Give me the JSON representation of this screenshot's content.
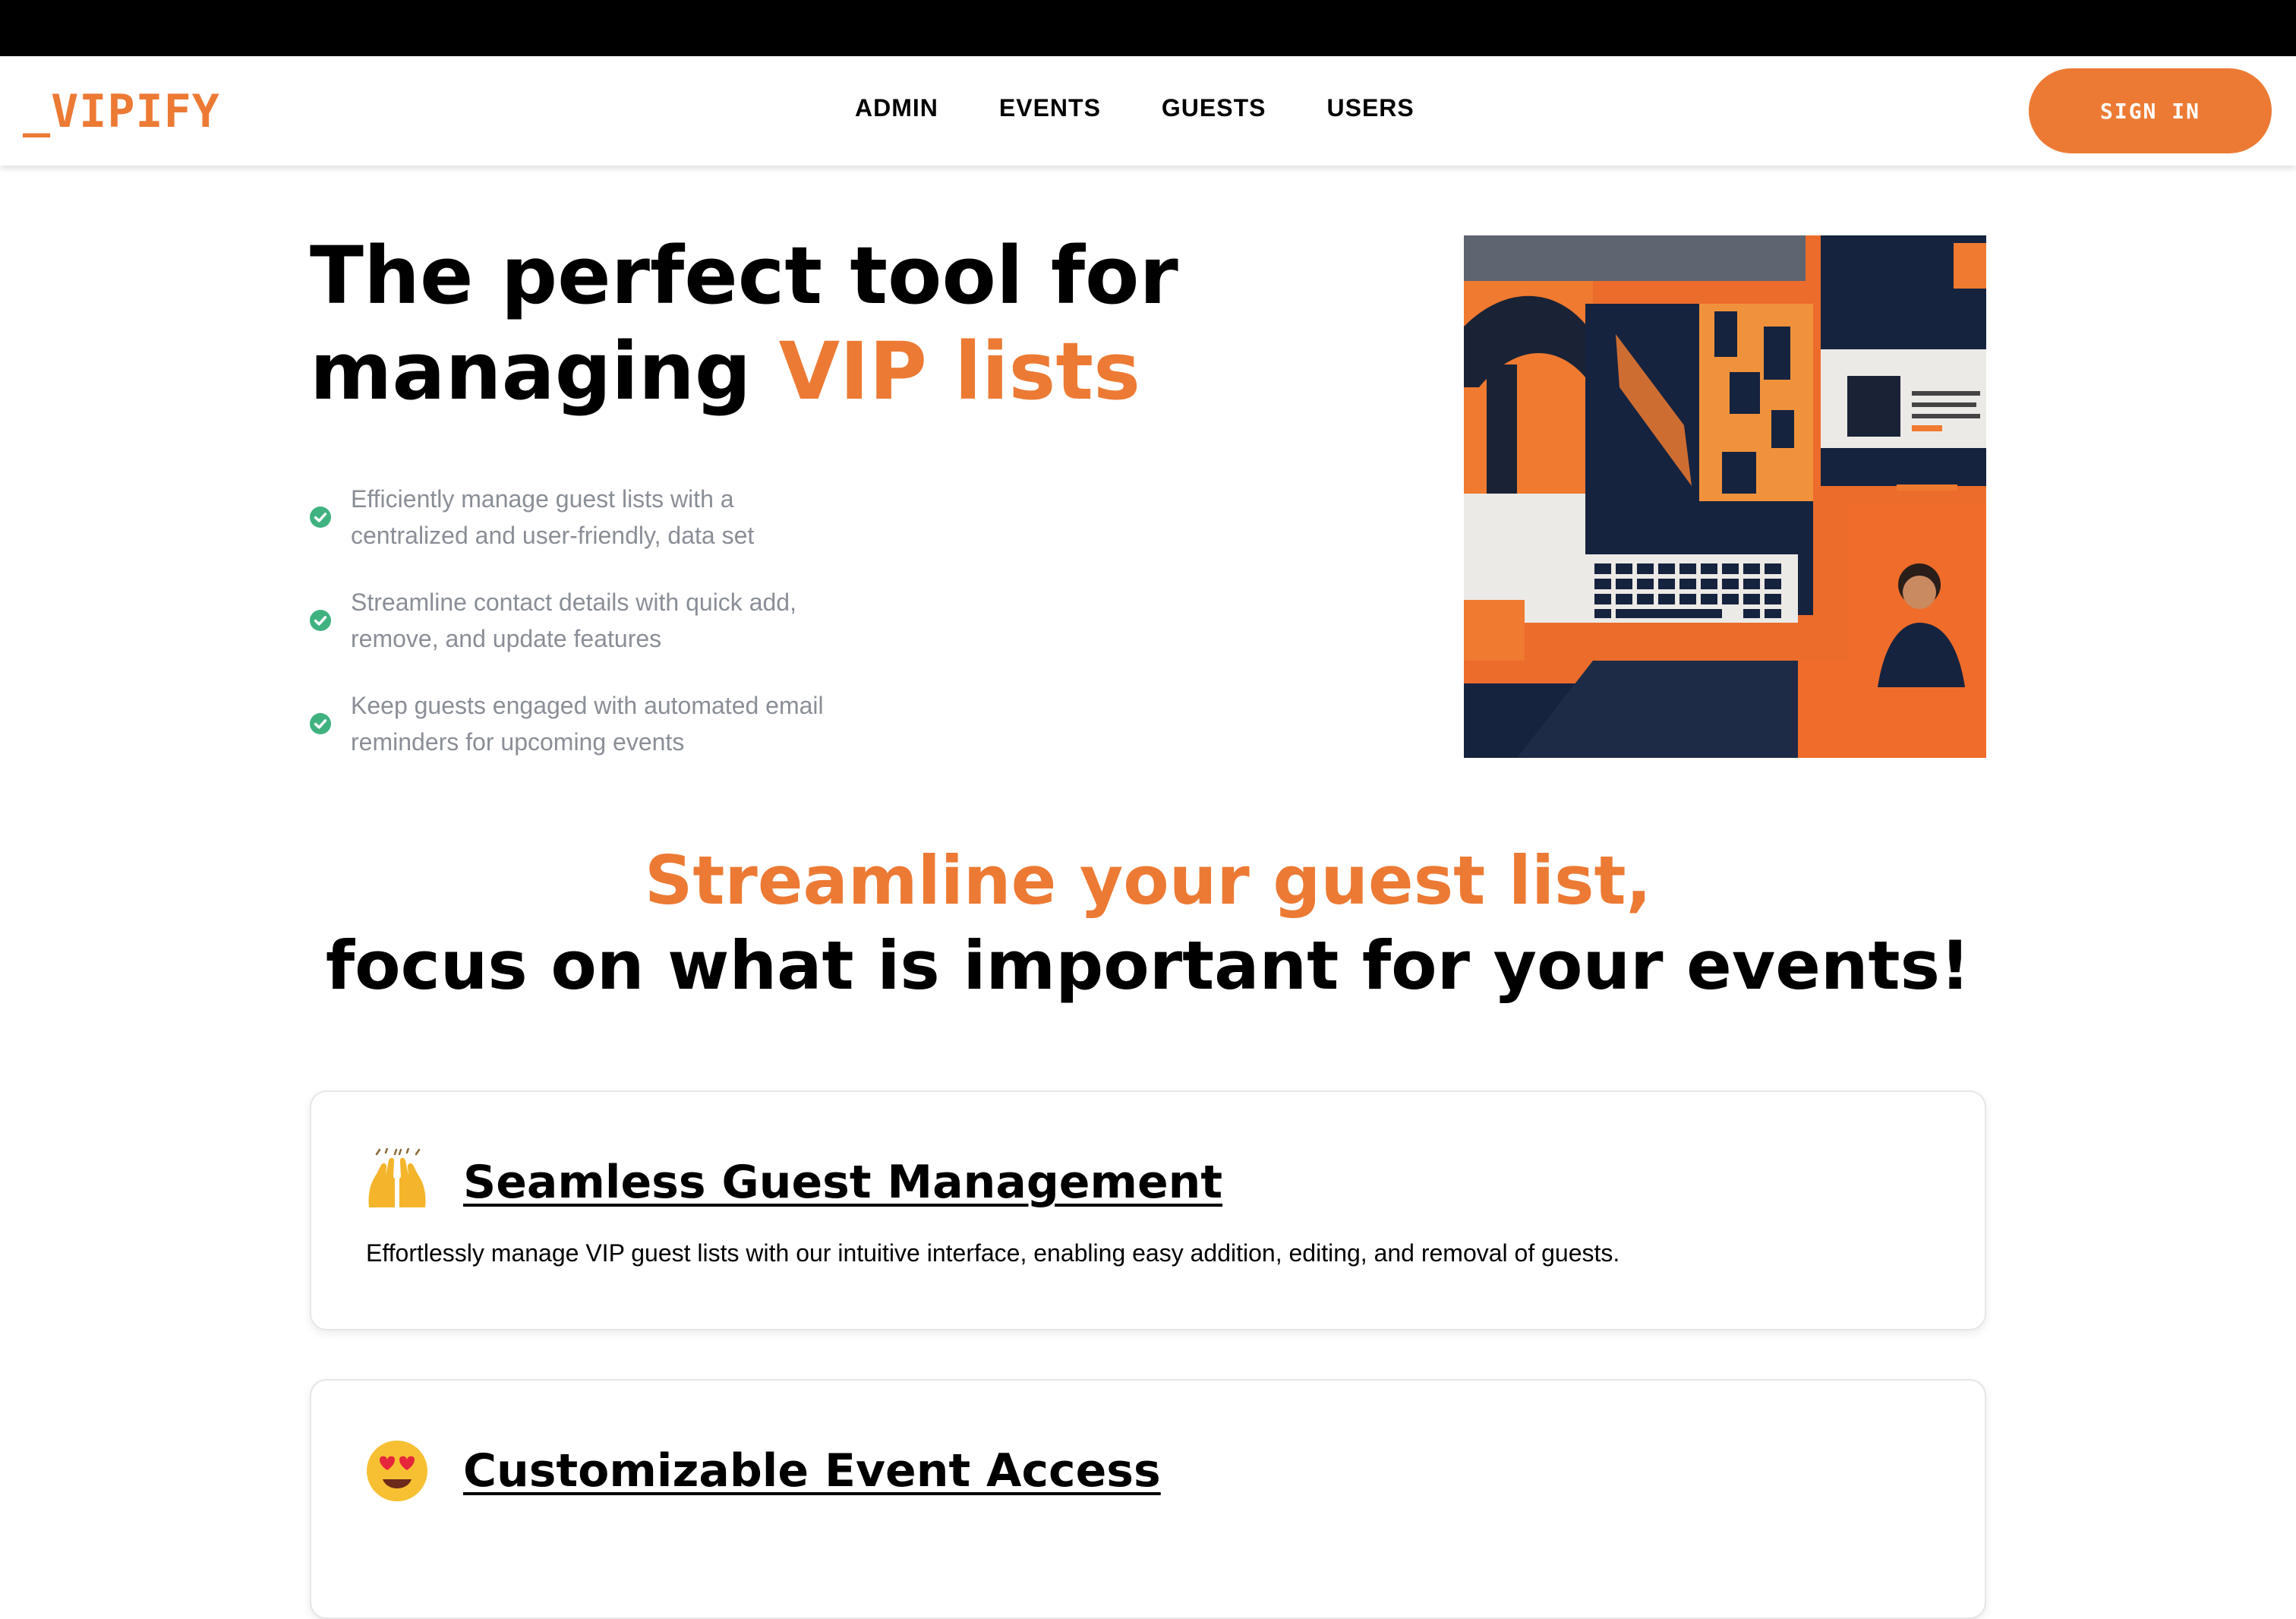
{
  "header": {
    "logo": "_VIPIFY",
    "nav": [
      {
        "label": "ADMIN"
      },
      {
        "label": "EVENTS"
      },
      {
        "label": "GUESTS"
      },
      {
        "label": "USERS"
      }
    ],
    "sign_in_label": "SIGN IN"
  },
  "hero": {
    "title_line1": "The perfect tool for",
    "title_line2_prefix": "managing ",
    "title_line2_accent": "VIP lists",
    "features": [
      {
        "icon": "check-circle-icon",
        "text": "Efficiently manage guest lists with a centralized and user-friendly, data set"
      },
      {
        "icon": "check-circle-icon",
        "text": "Streamline contact details with quick add, remove, and update features"
      },
      {
        "icon": "check-circle-icon",
        "text": "Keep guests engaged with automated email reminders for upcoming events"
      }
    ]
  },
  "section": {
    "title_line1": "Streamline your guest list,",
    "title_line2": "focus on what is important for your events!"
  },
  "cards": [
    {
      "emoji": "raising-hands-icon",
      "title": "Seamless Guest Management",
      "description": "Effortlessly manage VIP guest lists with our intuitive interface, enabling easy addition, editing, and removal of guests."
    },
    {
      "emoji": "heart-eyes-icon",
      "title": "Customizable Event Access",
      "description": ""
    }
  ],
  "colors": {
    "accent": "#ec7a34",
    "navy": "#16233f",
    "check": "#3fb27f",
    "muted_text": "#8a8e96"
  }
}
